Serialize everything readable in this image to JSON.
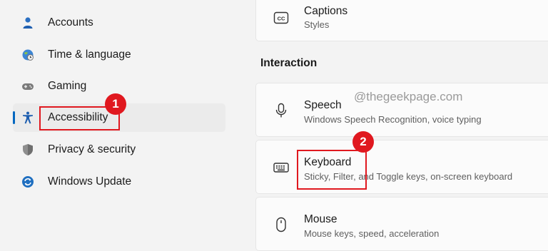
{
  "sidebar": {
    "items": [
      {
        "label": "Accounts",
        "icon": "person-icon"
      },
      {
        "label": "Time & language",
        "icon": "globe-clock-icon"
      },
      {
        "label": "Gaming",
        "icon": "gamepad-icon"
      },
      {
        "label": "Accessibility",
        "icon": "accessibility-icon",
        "selected": true
      },
      {
        "label": "Privacy & security",
        "icon": "shield-icon"
      },
      {
        "label": "Windows Update",
        "icon": "update-icon"
      }
    ]
  },
  "main": {
    "captions": {
      "title": "Captions",
      "subtitle": "Styles"
    },
    "section_heading": "Interaction",
    "speech": {
      "title": "Speech",
      "subtitle": "Windows Speech Recognition, voice typing"
    },
    "keyboard": {
      "title": "Keyboard",
      "subtitle": "Sticky, Filter, and Toggle keys, on-screen keyboard"
    },
    "mouse": {
      "title": "Mouse",
      "subtitle": "Mouse keys, speed, acceleration"
    }
  },
  "watermark": "@thegeekpage.com",
  "annotations": {
    "badge_1": "1",
    "badge_2": "2"
  },
  "colors": {
    "accent": "#0067c0",
    "highlight": "#e0181f"
  }
}
